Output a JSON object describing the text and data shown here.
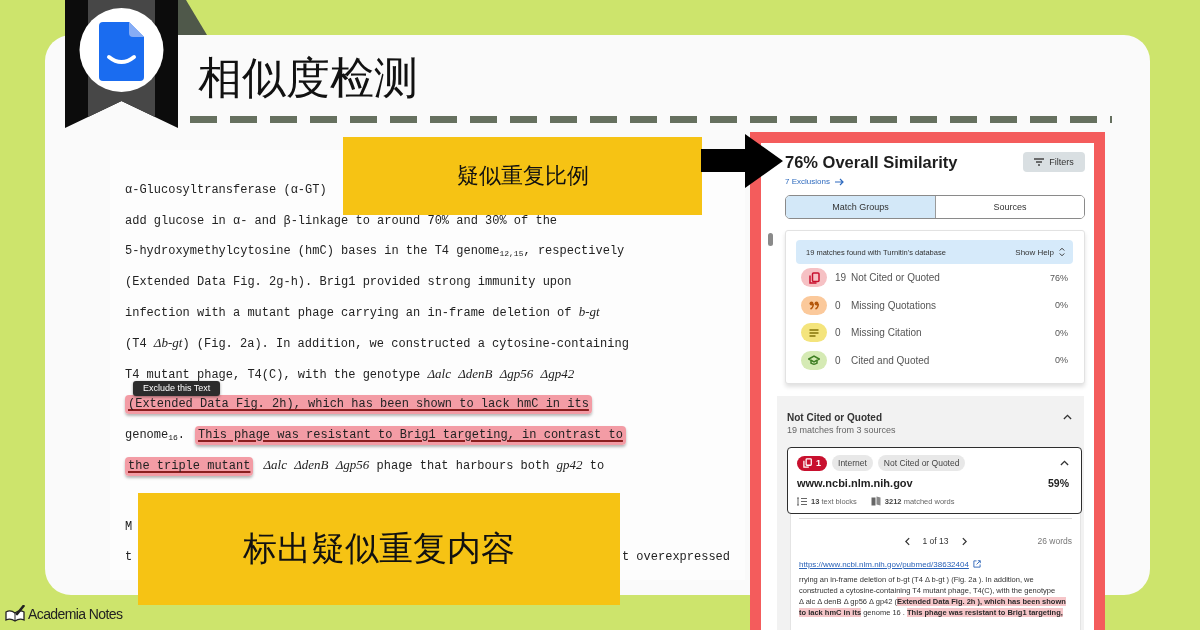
{
  "header": {
    "title": "相似度检测"
  },
  "document": {
    "lines": [
      {
        "segments": [
          {
            "text": "α-Glucosyltransferase (α-GT)",
            "highlighted": false
          }
        ]
      },
      {
        "segments": [
          {
            "text": "add glucose in α- and β-linkage to around 70% and 30% of the",
            "highlighted": false
          }
        ]
      },
      {
        "segments": [
          {
            "text": "5-hydroxymethylcytosine (hmC) bases in the T4 genome$_{12,15}$, respectively",
            "highlighted": false
          }
        ]
      },
      {
        "segments": [
          {
            "text": "(Extended Data Fig. 2g-h). Brig1 provided strong immunity upon",
            "highlighted": false
          }
        ]
      },
      {
        "segments": [
          {
            "text": "infection with a mutant phage carrying an in-frame deletion of *b-gt*",
            "highlighted": false
          }
        ]
      },
      {
        "segments": [
          {
            "text": "(T4 *Δb-gt*) (Fig. 2a). In addition, we constructed a cytosine-containing",
            "highlighted": false
          }
        ]
      },
      {
        "segments": [
          {
            "text": "T4 mutant phage, T4(C), with the genotype *Δalc* *ΔdenB* *Δgp56* *Δgp42*",
            "highlighted": false
          }
        ]
      },
      {
        "segments": [
          {
            "text": "(Extended Data Fig. 2h), which has been shown to lack hmC in its",
            "highlighted": true
          }
        ]
      },
      {
        "segments": [
          {
            "text": "genome$_{16}$.",
            "highlighted": false
          },
          {
            "text": "This phage was resistant to Brig1 targeting, in contrast to",
            "highlighted": true
          }
        ]
      },
      {
        "segments": [
          {
            "text": "the triple mutant",
            "highlighted": true
          },
          {
            "text": "*Δalc* *ΔdenB* *Δgp56* phage that harbours both *gp42* to",
            "highlighted": false
          }
        ]
      }
    ],
    "covered_lines": [
      {
        "start": "M"
      },
      {
        "start": "t",
        "end": "t overexpressed"
      }
    ],
    "tooltip": "Exclude this Text"
  },
  "ratio_callout": {
    "text": "疑似重复比例"
  },
  "content_callout": {
    "text": "标出疑似重复内容"
  },
  "similarity_panel": {
    "title": "76% Overall Similarity",
    "filters_button": "Filters",
    "exclusions_link": "7 Exclusions",
    "tabs": [
      {
        "label": "Match Groups",
        "selected": true
      },
      {
        "label": "Sources",
        "selected": false
      }
    ],
    "summary": {
      "message": "19 matches found with Turnitin's database",
      "help_toggle": "Show Help"
    },
    "groups": [
      {
        "kind": "not-cited",
        "count": "19",
        "label": "Not Cited or Quoted",
        "share": "76%",
        "color": "#f6c1c4"
      },
      {
        "kind": "missing-quotations",
        "count": "0",
        "label": "Missing Quotations",
        "share": "0%",
        "color": "#fbc99b"
      },
      {
        "kind": "missing-citation",
        "count": "0",
        "label": "Missing Citation",
        "share": "0%",
        "color": "#f4e47c"
      },
      {
        "kind": "cited-quoted",
        "count": "0",
        "label": "Cited and Quoted",
        "share": "0%",
        "color": "#d5eab4"
      }
    ],
    "section": {
      "title": "Not Cited or Quoted",
      "subtitle": "19 matches from 3 sources",
      "expanded": true,
      "source": {
        "badge": "1",
        "tags": [
          "Internet",
          "Not Cited or Quoted"
        ],
        "expanded": true,
        "domain": "www.ncbi.nlm.nih.gov",
        "share": "59%",
        "text_blocks": "**13** text blocks",
        "matched_words": "**3212** matched words",
        "pager": "1 of 13",
        "word_count": "26 words",
        "url": "https://www.ncbi.nlm.nih.gov/pubmed/38632404",
        "excerpt": [
          {
            "segments": [
              {
                "text": "rrying an in-frame deletion of b-gt (T4 Δ b-gt ) (Fig. 2a ). In addition, we",
                "highlighted": false
              }
            ]
          },
          {
            "segments": [
              {
                "text": "constructed a cytosine-containing T4 mutant phage, T4(C), with the genotype",
                "highlighted": false
              }
            ]
          },
          {
            "segments": [
              {
                "text": "Δ alc Δ denB Δ gp56 Δ gp42 (",
                "highlighted": false
              },
              {
                "text": "Extended Data Fig. 2h ), which has been shown",
                "highlighted": true
              }
            ]
          },
          {
            "segments": [
              {
                "text": "to lack hmC in its",
                "highlighted": true
              },
              {
                "text": " genome 16 . ",
                "highlighted": false
              },
              {
                "text": "This phage was resistant to Brig1 targeting,",
                "highlighted": true
              }
            ]
          }
        ]
      }
    }
  },
  "footer": {
    "brand": "Academia Notes"
  }
}
